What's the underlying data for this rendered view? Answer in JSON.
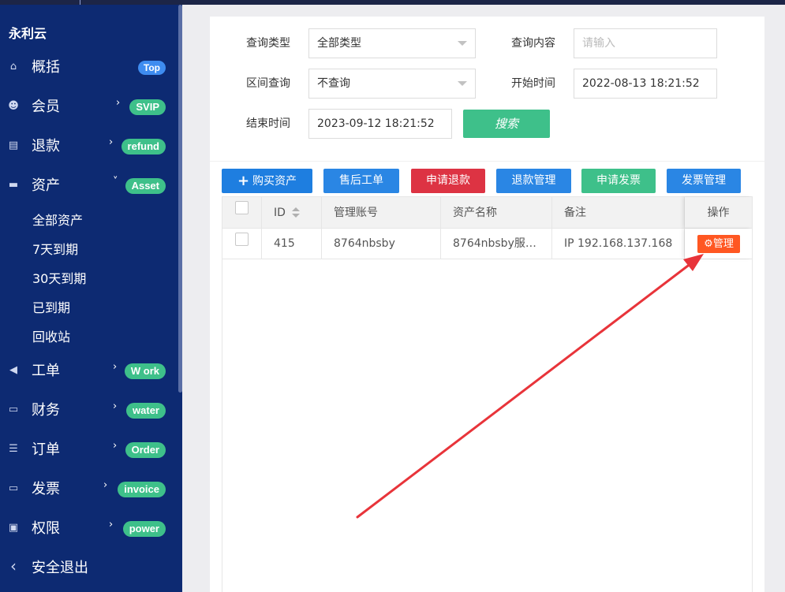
{
  "sidebar": {
    "brand": "永利云",
    "items": [
      {
        "label": "概括",
        "icon": "home-icon",
        "badge": "Top"
      },
      {
        "label": "会员",
        "icon": "users-icon",
        "badge": "SVIP"
      },
      {
        "label": "退款",
        "icon": "card-icon",
        "badge": "refund"
      },
      {
        "label": "资产",
        "icon": "wallet-icon",
        "badge": "Asset"
      },
      {
        "label": "工单",
        "icon": "megaphone-icon",
        "badge": "W ork"
      },
      {
        "label": "财务",
        "icon": "clipboard-icon",
        "badge": "water"
      },
      {
        "label": "订单",
        "icon": "list-icon",
        "badge": "Order"
      },
      {
        "label": "发票",
        "icon": "receipt-icon",
        "badge": "invoice"
      },
      {
        "label": "权限",
        "icon": "id-card-icon",
        "badge": "power"
      }
    ],
    "asset_sub": [
      "全部资产",
      "7天到期",
      "30天到期",
      "已到期",
      "回收站"
    ],
    "logout": "安全退出",
    "chevron": "›",
    "chevron_open": "˅",
    "back": "‹"
  },
  "filters": {
    "type_label": "查询类型",
    "type_value": "全部类型",
    "content_label": "查询内容",
    "content_placeholder": "请输入",
    "range_label": "区间查询",
    "range_value": "不查询",
    "start_label": "开始时间",
    "start_value": "2022-08-13 18:21:52",
    "end_label": "结束时间",
    "end_value": "2023-09-12 18:21:52",
    "search_btn": "搜索"
  },
  "toolbar": {
    "buy": "购买资产",
    "after_sales": "售后工单",
    "apply_refund": "申请退款",
    "refund_manage": "退款管理",
    "apply_invoice": "申请发票",
    "invoice_manage": "发票管理"
  },
  "table": {
    "headers": {
      "id": "ID",
      "account": "管理账号",
      "asset_name": "资产名称",
      "remark": "备注",
      "action": "操作"
    },
    "rows": [
      {
        "id": "415",
        "account": "8764nbsby",
        "asset_name": "8764nbsby服…",
        "remark": "IP 192.168.137.168",
        "action": "管理"
      }
    ]
  },
  "colors": {
    "sidebar_bg": "#0d2a72",
    "badge_green": "#3ec08a",
    "btn_blue": "#1e7ee0",
    "btn_red": "#dd3343",
    "manage_orange": "#ff5722",
    "arrow_red": "#e8343a"
  }
}
